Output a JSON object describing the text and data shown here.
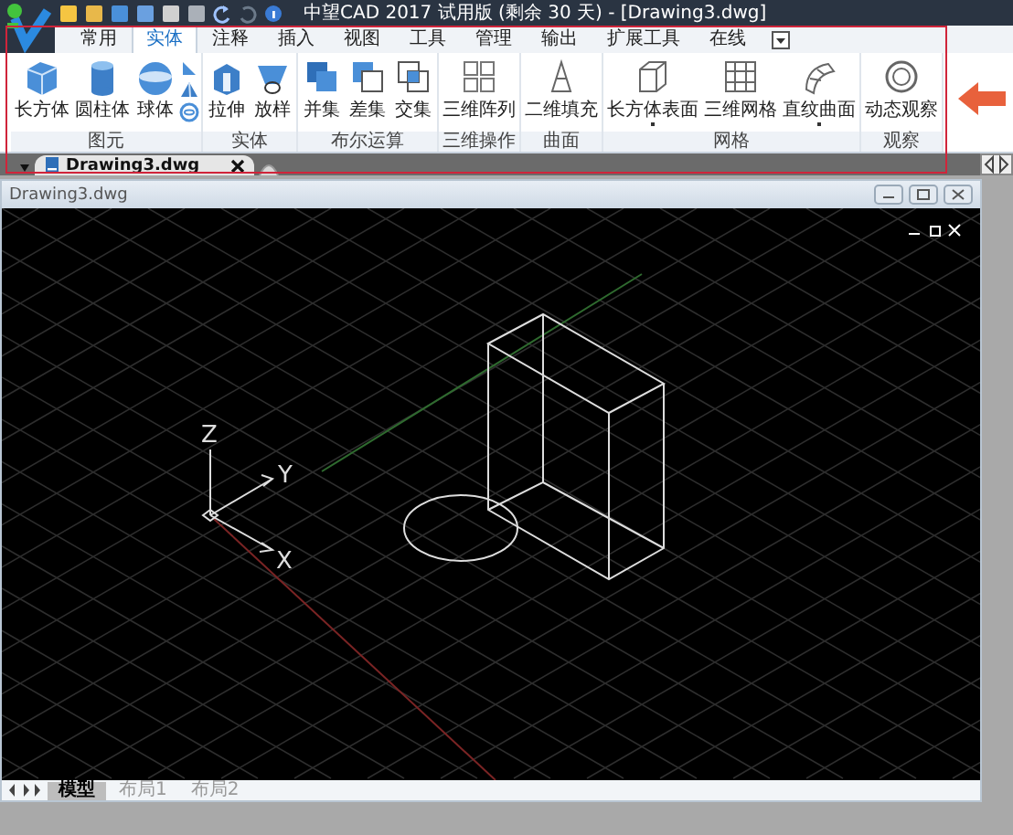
{
  "window": {
    "title": "中望CAD 2017 试用版 (剩余 30 天) - [Drawing3.dwg]"
  },
  "menu_tabs": [
    {
      "label": "常用",
      "selected": false
    },
    {
      "label": "实体",
      "selected": true
    },
    {
      "label": "注释",
      "selected": false
    },
    {
      "label": "插入",
      "selected": false
    },
    {
      "label": "视图",
      "selected": false
    },
    {
      "label": "工具",
      "selected": false
    },
    {
      "label": "管理",
      "selected": false
    },
    {
      "label": "输出",
      "selected": false
    },
    {
      "label": "扩展工具",
      "selected": false
    },
    {
      "label": "在线",
      "selected": false
    }
  ],
  "ribbon_groups": [
    {
      "label": "图元",
      "tools": [
        {
          "label": "长方体",
          "dropdown": false
        },
        {
          "label": "圆柱体",
          "dropdown": false
        },
        {
          "label": "球体",
          "dropdown": false
        }
      ]
    },
    {
      "label": "实体",
      "tools": [
        {
          "label": "拉伸",
          "dropdown": false
        },
        {
          "label": "放样",
          "dropdown": false
        }
      ]
    },
    {
      "label": "布尔运算",
      "tools": [
        {
          "label": "并集",
          "dropdown": false
        },
        {
          "label": "差集",
          "dropdown": false
        },
        {
          "label": "交集",
          "dropdown": false
        }
      ]
    },
    {
      "label": "三维操作",
      "tools": [
        {
          "label": "三维阵列",
          "dropdown": false
        }
      ]
    },
    {
      "label": "曲面",
      "tools": [
        {
          "label": "二维填充",
          "dropdown": false
        }
      ]
    },
    {
      "label": "网格",
      "tools": [
        {
          "label": "长方体表面",
          "dropdown": true
        },
        {
          "label": "三维网格",
          "dropdown": false
        },
        {
          "label": "直纹曲面",
          "dropdown": true
        }
      ]
    },
    {
      "label": "观察",
      "tools": [
        {
          "label": "动态观察",
          "dropdown": false
        }
      ]
    }
  ],
  "document_tabs": [
    {
      "label": "Drawing3.dwg",
      "selected": true
    }
  ],
  "drawing_window": {
    "title": "Drawing3.dwg"
  },
  "axes": {
    "z": "Z",
    "y": "Y",
    "x": "X"
  },
  "layout_tabs": [
    {
      "label": "模型",
      "selected": true
    },
    {
      "label": "布局1",
      "selected": false
    },
    {
      "label": "布局2",
      "selected": false
    }
  ]
}
